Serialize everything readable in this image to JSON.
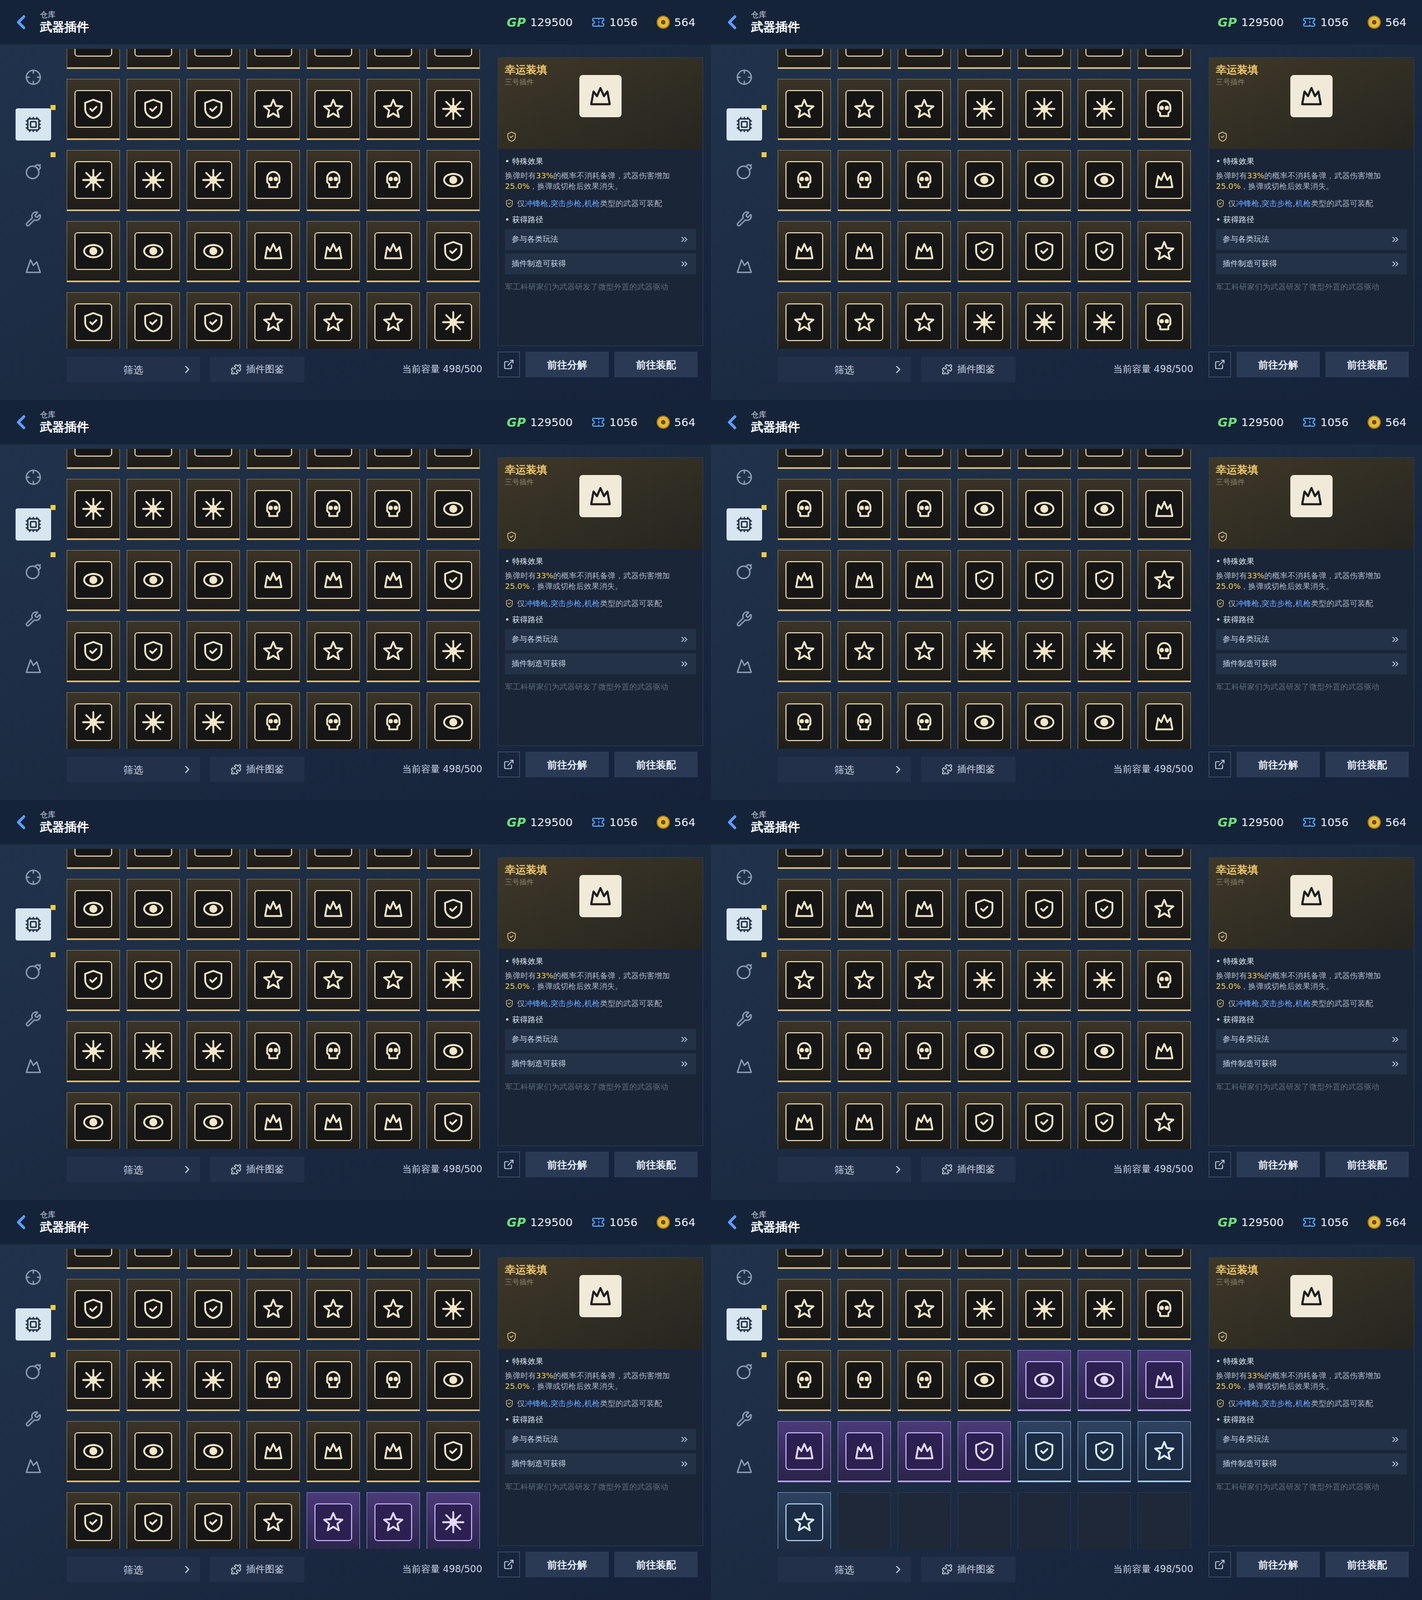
{
  "header": {
    "breadcrumb": "仓库",
    "title": "武器插件"
  },
  "currencies": [
    {
      "kind": "gp",
      "label": "GP",
      "value": "129500"
    },
    {
      "kind": "ticket",
      "value": "1056"
    },
    {
      "kind": "coin",
      "value": "564"
    }
  ],
  "sidebar": {
    "items": [
      {
        "selected": false,
        "badge": false
      },
      {
        "selected": true,
        "badge": true
      },
      {
        "selected": false,
        "badge": true
      },
      {
        "selected": false,
        "badge": false
      },
      {
        "selected": false,
        "badge": false
      }
    ]
  },
  "detail": {
    "name": "幸运装填",
    "subtitle": "三号插件",
    "effect_label": "特殊效果",
    "description": [
      {
        "text": "换弹时有",
        "highlight": false
      },
      {
        "text": "33%",
        "highlight": true
      },
      {
        "text": "的概率不消耗备弹，武器伤害增加",
        "highlight": false
      },
      {
        "text": "25.0%",
        "highlight": true
      },
      {
        "text": "，换弹或切枪后效果消失。",
        "highlight": false
      }
    ],
    "restriction": [
      {
        "text": "仅",
        "highlight": false
      },
      {
        "text": "冲锋枪,突击步枪,机枪",
        "highlight": true
      },
      {
        "text": "类型的武器可装配",
        "highlight": false
      }
    ],
    "sources_label": "获得路径",
    "sources": [
      "参与各类玩法",
      "插件制造可获得"
    ],
    "lore": "军工科研家们为武器研发了微型外置的武器驱动"
  },
  "bottom": {
    "filter": "筛选",
    "catalog": "插件图鉴",
    "capacity": "当前容量 498/500",
    "decompose": "前往分解",
    "equip": "前往装配"
  },
  "panels": [
    {
      "rows": [
        [
          "gold",
          "gold",
          "gold",
          "gold",
          "gold",
          "gold",
          "gold"
        ],
        [
          "gold",
          "gold",
          "gold",
          "gold",
          "gold",
          "gold",
          "gold"
        ],
        [
          "gold",
          "gold",
          "gold",
          "gold",
          "gold",
          "gold",
          "gold"
        ],
        [
          "gold",
          "gold",
          "gold",
          "gold",
          "gold",
          "gold",
          "gold"
        ],
        [
          "gold",
          "gold",
          "gold",
          "gold",
          "gold",
          "gold",
          "gold"
        ]
      ]
    },
    {
      "rows": [
        [
          "gold",
          "gold",
          "gold",
          "gold",
          "gold",
          "gold",
          "gold"
        ],
        [
          "gold",
          "gold",
          "gold",
          "gold",
          "gold",
          "gold",
          "gold"
        ],
        [
          "gold",
          "gold",
          "gold",
          "gold",
          "gold",
          "gold",
          "gold"
        ],
        [
          "gold",
          "gold",
          "gold",
          "gold",
          "gold",
          "gold",
          "gold"
        ],
        [
          "gold",
          "gold",
          "gold",
          "gold",
          "gold",
          "gold",
          "gold"
        ]
      ]
    },
    {
      "rows": [
        [
          "gold",
          "gold",
          "gold",
          "gold",
          "gold",
          "gold",
          "gold"
        ],
        [
          "gold",
          "gold",
          "gold",
          "gold",
          "gold",
          "gold",
          "gold"
        ],
        [
          "gold",
          "gold",
          "gold",
          "gold",
          "gold",
          "gold",
          "gold"
        ],
        [
          "gold",
          "gold",
          "gold",
          "gold",
          "gold",
          "gold",
          "gold"
        ],
        [
          "gold",
          "gold",
          "gold",
          "gold",
          "gold",
          "gold",
          "gold"
        ]
      ]
    },
    {
      "rows": [
        [
          "gold",
          "gold",
          "gold",
          "gold",
          "gold",
          "gold",
          "gold"
        ],
        [
          "gold",
          "gold",
          "gold",
          "gold",
          "gold",
          "gold",
          "gold"
        ],
        [
          "gold",
          "gold",
          "gold",
          "gold",
          "gold",
          "gold",
          "gold"
        ],
        [
          "gold",
          "gold",
          "gold",
          "gold",
          "gold",
          "gold",
          "gold"
        ],
        [
          "gold",
          "gold",
          "gold",
          "gold",
          "gold",
          "gold",
          "gold"
        ]
      ]
    },
    {
      "rows": [
        [
          "gold",
          "gold",
          "gold",
          "gold",
          "gold",
          "gold",
          "gold"
        ],
        [
          "gold",
          "gold",
          "gold",
          "gold",
          "gold",
          "gold",
          "gold"
        ],
        [
          "gold",
          "gold",
          "gold",
          "gold",
          "gold",
          "gold",
          "gold"
        ],
        [
          "gold",
          "gold",
          "gold",
          "gold",
          "gold",
          "gold",
          "gold"
        ],
        [
          "gold",
          "gold",
          "gold",
          "gold",
          "gold",
          "gold",
          "gold"
        ]
      ]
    },
    {
      "rows": [
        [
          "gold",
          "gold",
          "gold",
          "gold",
          "gold",
          "gold",
          "gold"
        ],
        [
          "gold",
          "gold",
          "gold",
          "gold",
          "gold",
          "gold",
          "gold"
        ],
        [
          "gold",
          "gold",
          "gold",
          "gold",
          "gold",
          "gold",
          "gold"
        ],
        [
          "gold",
          "gold",
          "gold",
          "gold",
          "gold",
          "gold",
          "gold"
        ],
        [
          "gold",
          "gold",
          "gold",
          "gold",
          "gold",
          "gold",
          "gold"
        ]
      ]
    },
    {
      "rows": [
        [
          "gold",
          "gold",
          "gold",
          "gold",
          "gold",
          "gold",
          "gold"
        ],
        [
          "gold",
          "gold",
          "gold",
          "gold",
          "gold",
          "gold",
          "gold"
        ],
        [
          "gold",
          "gold",
          "gold",
          "gold",
          "gold",
          "gold",
          "gold"
        ],
        [
          "gold",
          "gold",
          "gold",
          "gold",
          "gold",
          "gold",
          "gold"
        ],
        [
          "gold",
          "gold",
          "gold",
          "gold",
          "purple",
          "purple",
          "purple"
        ]
      ]
    },
    {
      "rows": [
        [
          "gold",
          "gold",
          "gold",
          "gold",
          "gold",
          "gold",
          "gold"
        ],
        [
          "gold",
          "gold",
          "gold",
          "gold",
          "gold",
          "gold",
          "gold"
        ],
        [
          "gold",
          "gold",
          "gold",
          "gold",
          "purple",
          "purple",
          "purple"
        ],
        [
          "purple",
          "purple",
          "purple",
          "purple",
          "blue",
          "blue",
          "blue"
        ],
        [
          "blue",
          "empty",
          "empty",
          "empty",
          "empty",
          "empty",
          "empty"
        ]
      ]
    }
  ]
}
